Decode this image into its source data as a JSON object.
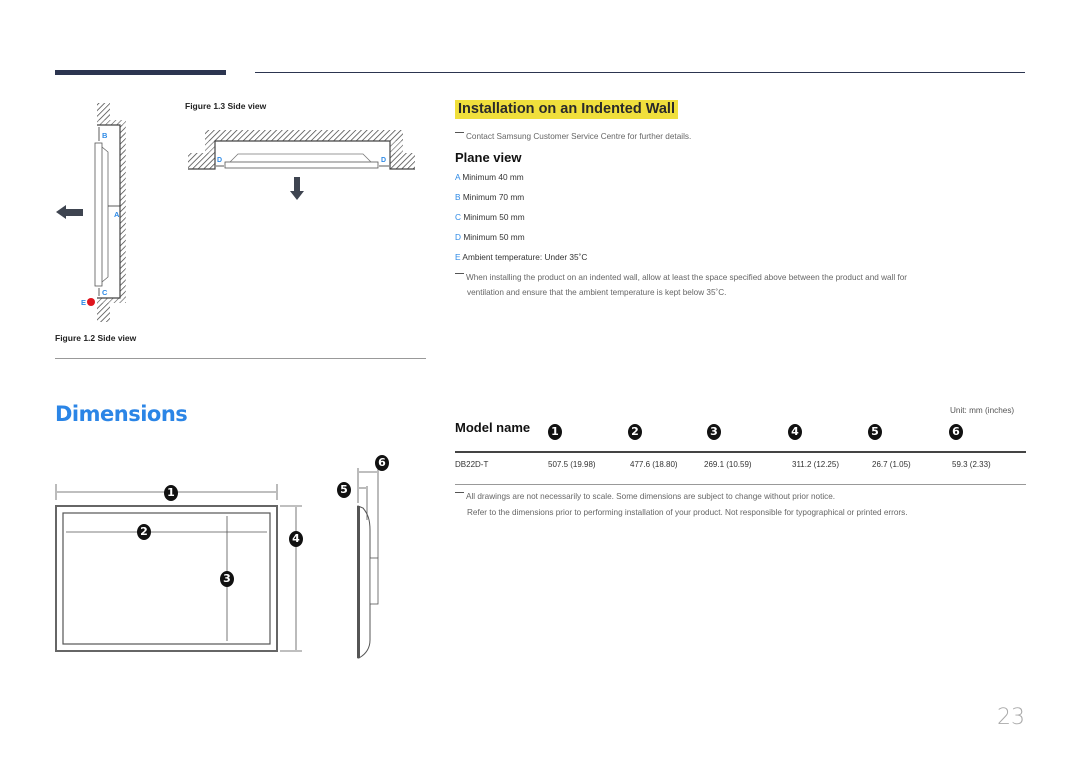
{
  "figures": {
    "fig_1_3": "Figure 1.3 Side view",
    "fig_1_2": "Figure 1.2 Side view",
    "labels": {
      "a": "A",
      "b": "B",
      "c": "C",
      "d": "D",
      "e": "E"
    }
  },
  "installation": {
    "heading": "Installation on an Indented Wall",
    "contact_note": "Contact Samsung Customer Service Centre for further details.",
    "plane_view": "Plane view",
    "specs": [
      {
        "letter": "A",
        "text": "Minimum 40 mm"
      },
      {
        "letter": "B",
        "text": "Minimum 70 mm"
      },
      {
        "letter": "C",
        "text": "Minimum 50 mm"
      },
      {
        "letter": "D",
        "text": "Minimum 50 mm"
      },
      {
        "letter": "E",
        "text": "Ambient temperature: Under 35˚C"
      }
    ],
    "warning_line1": "When installing the product on an indented wall, allow at least the space specified above between the product and wall for",
    "warning_line2": "ventilation and ensure that the ambient temperature is kept below 35˚C."
  },
  "dimensions": {
    "title": "Dimensions",
    "unit": "Unit: mm (inches)",
    "model_header": "Model name",
    "columns": [
      "1",
      "2",
      "3",
      "4",
      "5",
      "6"
    ],
    "rows": [
      {
        "model": "DB22D-T",
        "values": [
          "507.5 (19.98)",
          "477.6 (18.80)",
          "269.1 (10.59)",
          "311.2 (12.25)",
          "26.7 (1.05)",
          "59.3 (2.33)"
        ]
      }
    ],
    "note_line1": "All drawings are not necessarily to scale. Some dimensions are subject to change without prior notice.",
    "note_line2": "Refer to the dimensions prior to performing installation of your product. Not responsible for typographical or printed errors.",
    "diagram_markers": [
      "1",
      "2",
      "3",
      "4",
      "5",
      "6"
    ]
  },
  "page_number": "23",
  "colors": {
    "accent_blue": "#2b85e6",
    "highlight_yellow": "#f0df3c",
    "marker_red": "#e0141e",
    "header_bar": "#2c3550"
  }
}
